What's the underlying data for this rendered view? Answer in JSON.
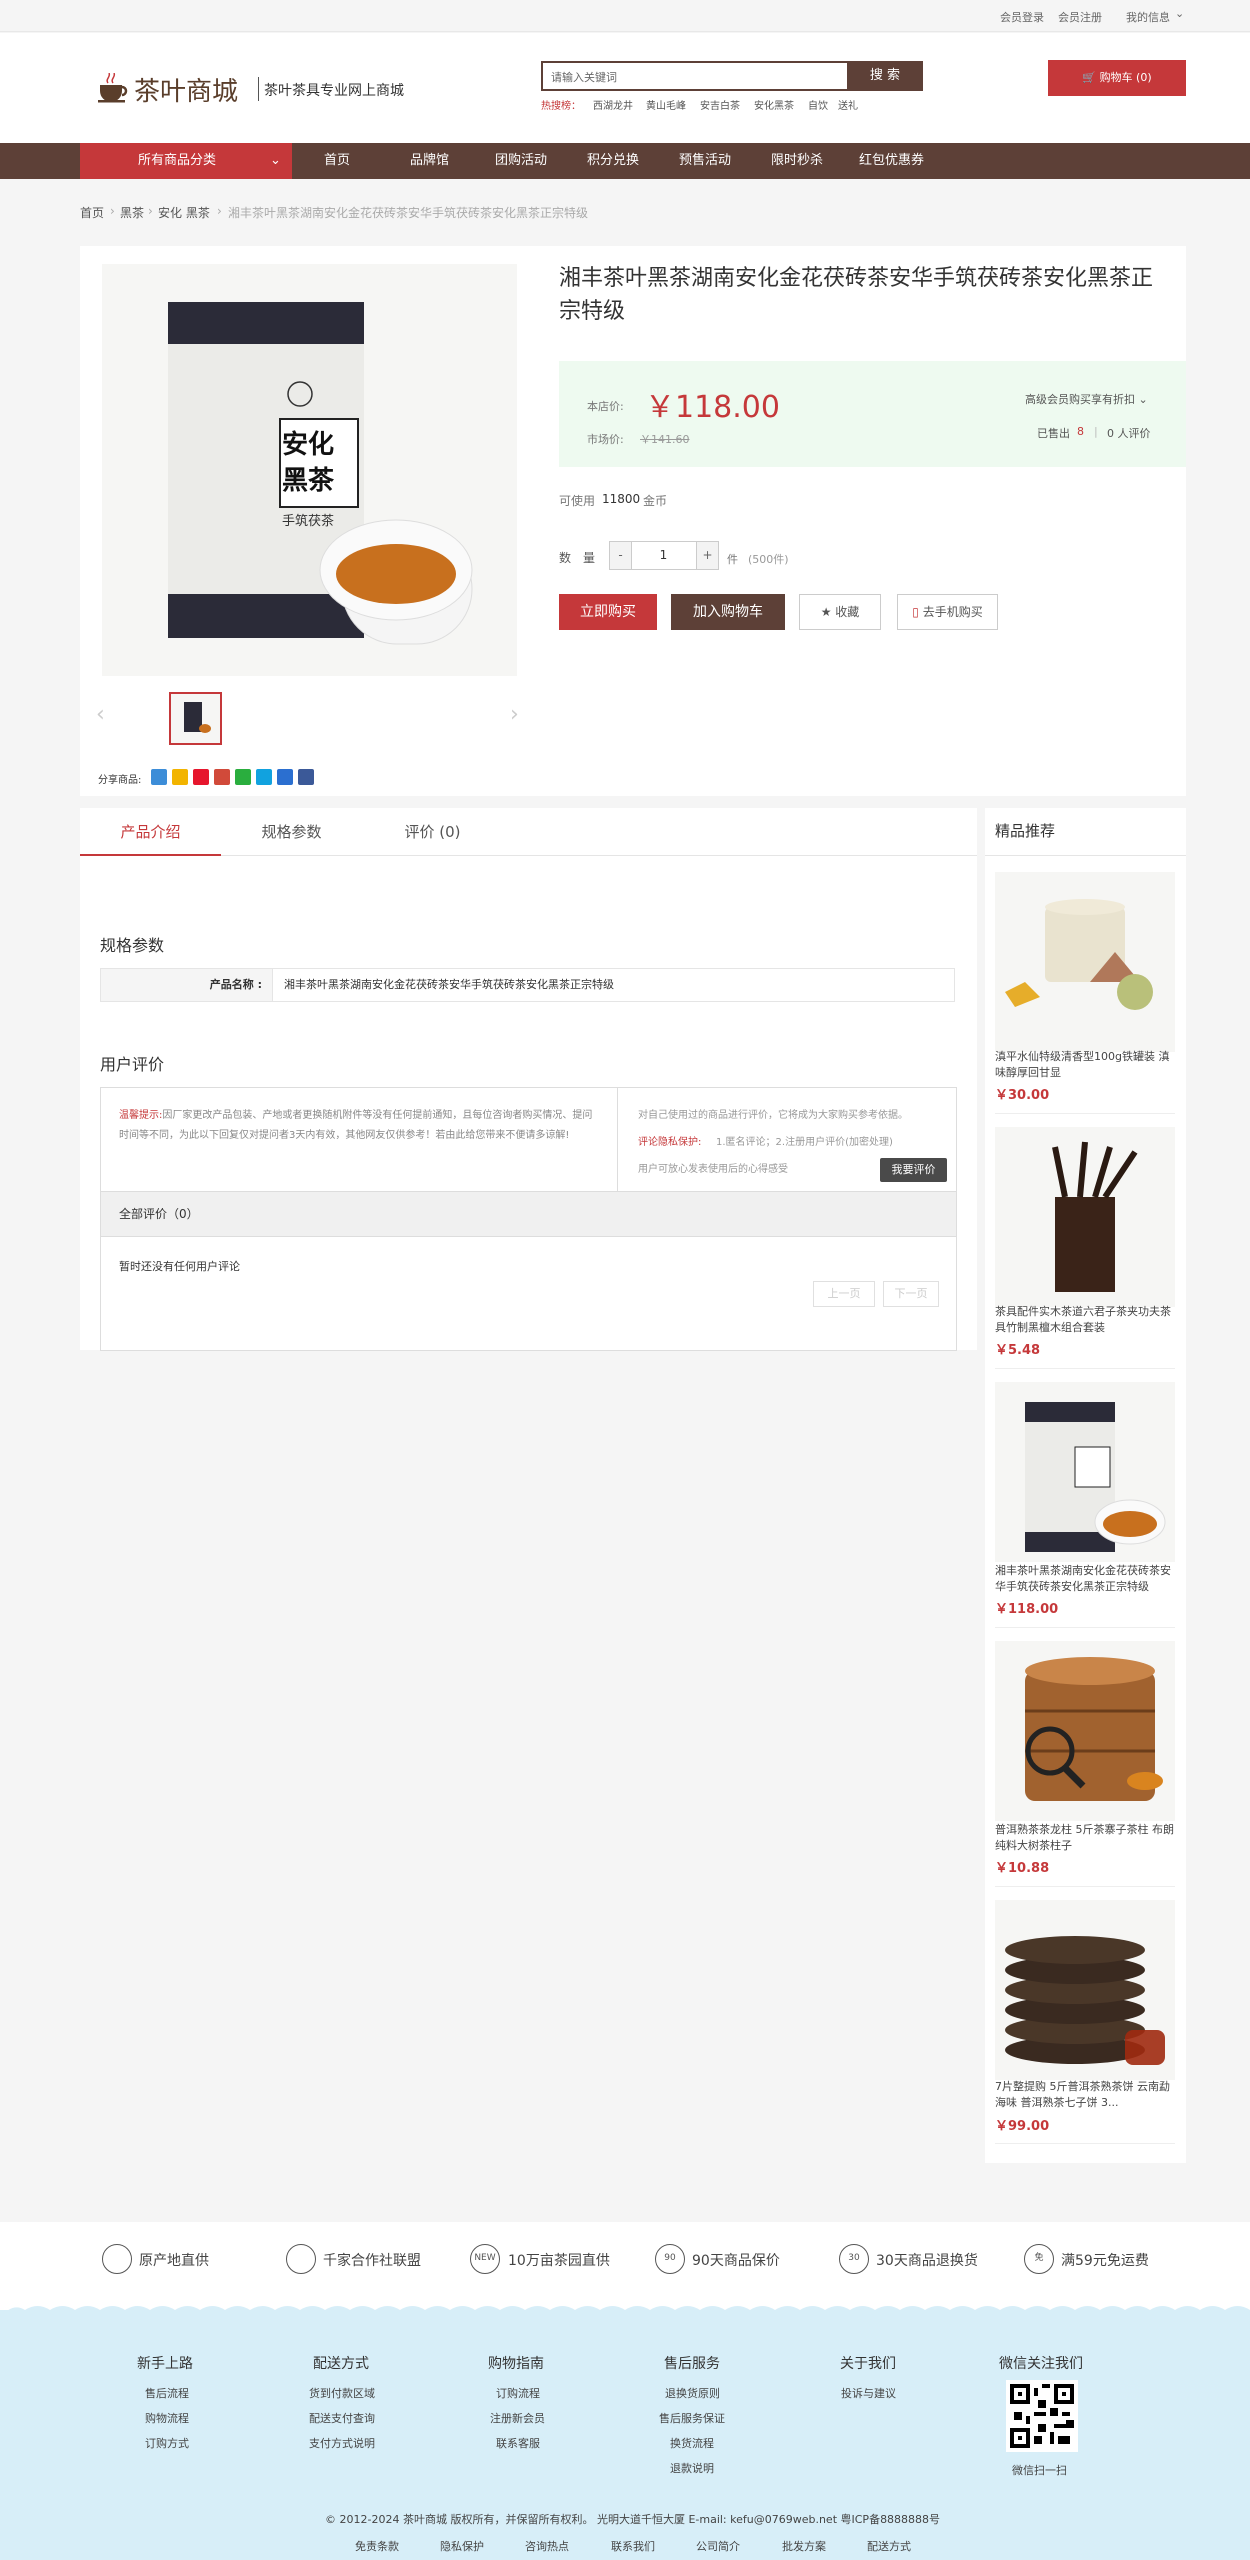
{
  "topbar": {
    "login": "会员登录",
    "register": "会员注册",
    "my_info": "我的信息",
    "chevron": "chevron-down-icon"
  },
  "header": {
    "logo_text": "茶叶商城",
    "slogan": "茶叶茶具专业网上商城",
    "search_placeholder": "请输入关键词",
    "search_button": "搜 索",
    "hot_label": "热搜榜：",
    "hot_items": [
      "西湖龙井",
      "黄山毛峰",
      "安吉白茶",
      "安化黑茶",
      "自饮",
      "送礼"
    ],
    "cart_label": "购物车 (0)"
  },
  "nav": {
    "all_categories": "所有商品分类",
    "items": [
      "首页",
      "品牌馆",
      "团购活动",
      "积分兑换",
      "预售活动",
      "限时秒杀",
      "红包优惠券"
    ]
  },
  "breadcrumb": [
    "首页",
    "黑茶",
    "安化 黑茶",
    "湘丰茶叶黑茶湖南安化金花茯砖茶安华手筑茯砖茶安化黑茶正宗特级"
  ],
  "product": {
    "title": "湘丰茶叶黑茶湖南安化金花茯砖茶安华手筑茯砖茶安化黑茶正宗特级",
    "price_label": "本店价:",
    "price": "￥118.00",
    "market_label": "市场价:",
    "market_price": "￥141.60",
    "member_discount": "高级会员购买享有折扣",
    "sold_label": "已售出",
    "sold_count": "8",
    "reviews_label": "0 人评价",
    "points_prefix": "可使用",
    "points_value": "11800",
    "points_suffix": "金币",
    "qty_label": "数　量",
    "qty_minus": "-",
    "qty_value": "1",
    "qty_plus": "+",
    "qty_unit": "件",
    "stock": "(500件)",
    "buy_now": "立即购买",
    "add_cart": "加入购物车",
    "favorite": "收藏",
    "mobile_buy": "去手机购买",
    "share_label": "分享商品:",
    "box_label_1": "安化",
    "box_label_2": "黑茶",
    "box_label_3": "手筑茯茶"
  },
  "tabs": [
    "产品介绍",
    "规格参数",
    "评价 (0)"
  ],
  "spec": {
    "title": "规格参数",
    "name_label": "产品名称 :",
    "name_value": "湘丰茶叶黑茶湖南安化金花茯砖茶安华手筑茯砖茶安化黑茶正宗特级"
  },
  "reviews": {
    "title": "用户评价",
    "tip_label": "温馨提示:",
    "tip_text": "因厂家更改产品包装、产地或者更换随机附件等没有任何提前通知，且每位咨询者购买情况、提问时间等不同，为此以下回复仅对提问者3天内有效，其他网友仅供参考！若由此给您带来不便请多谅解!",
    "right_intro": "对自己使用过的商品进行评价，它将成为大家购买参考依据。",
    "privacy_label": "评论隐私保护:",
    "privacy_text": "1.匿名评论；2.注册用户评价(加密处理)",
    "trust_text": "用户可放心发表使用后的心得感受",
    "write_btn": "我要评价",
    "all_label": "全部评价（0）",
    "empty": "暂时还没有任何用户评论",
    "prev": "上一页",
    "next": "下一页"
  },
  "sidebar": {
    "title": "精品推荐",
    "items": [
      {
        "name": "滇平水仙特级清香型100g铁罐装 滇味醇厚回甘显",
        "price": "￥30.00"
      },
      {
        "name": "茶具配件实木茶道六君子茶夹功夫茶具竹制黑檀木组合套装",
        "price": "￥5.48"
      },
      {
        "name": "湘丰茶叶黑茶湖南安化金花茯砖茶安华手筑茯砖茶安化黑茶正宗特级",
        "price": "￥118.00"
      },
      {
        "name": "普洱熟茶茶龙柱 5斤茶寨子茶柱 布朗纯料大树茶柱子",
        "price": "￥10.88"
      },
      {
        "name": "7片整提购 5斤普洱茶熟茶饼 云南勐海味 普洱熟茶七子饼 3...",
        "price": "￥99.00"
      }
    ]
  },
  "features": [
    {
      "icon": "location-icon",
      "text": "原产地直供"
    },
    {
      "icon": "handshake-icon",
      "text": "千家合作社联盟"
    },
    {
      "icon": "new-badge-icon",
      "text": "10万亩茶园直供"
    },
    {
      "icon": "90-days-icon",
      "text": "90天商品保价"
    },
    {
      "icon": "30-days-icon",
      "text": "30天商品退换货"
    },
    {
      "icon": "free-shipping-icon",
      "text": "满59元免运费"
    }
  ],
  "feature_glyphs": [
    "",
    "",
    "NEW",
    "90",
    "30",
    "免"
  ],
  "footer": {
    "columns": [
      {
        "title": "新手上路",
        "links": [
          "售后流程",
          "购物流程",
          "订购方式"
        ]
      },
      {
        "title": "配送方式",
        "links": [
          "货到付款区域",
          "配送支付查询",
          "支付方式说明"
        ]
      },
      {
        "title": "购物指南",
        "links": [
          "订购流程",
          "注册新会员",
          "联系客服"
        ]
      },
      {
        "title": "售后服务",
        "links": [
          "退换货原则",
          "售后服务保证",
          "换货流程",
          "退款说明"
        ]
      },
      {
        "title": "关于我们",
        "links": [
          "投诉与建议"
        ]
      }
    ],
    "wechat_title": "微信关注我们",
    "wechat_scan": "微信扫一扫",
    "copyright": "© 2012-2024 茶叶商城 版权所有，并保留所有权利。 光明大道千恒大厦 E-mail: kefu@0769web.net 粤ICP备8888888号",
    "bottom_links": [
      "免责条款",
      "隐私保护",
      "咨询热点",
      "联系我们",
      "公司简介",
      "批发方案",
      "配送方式"
    ]
  }
}
